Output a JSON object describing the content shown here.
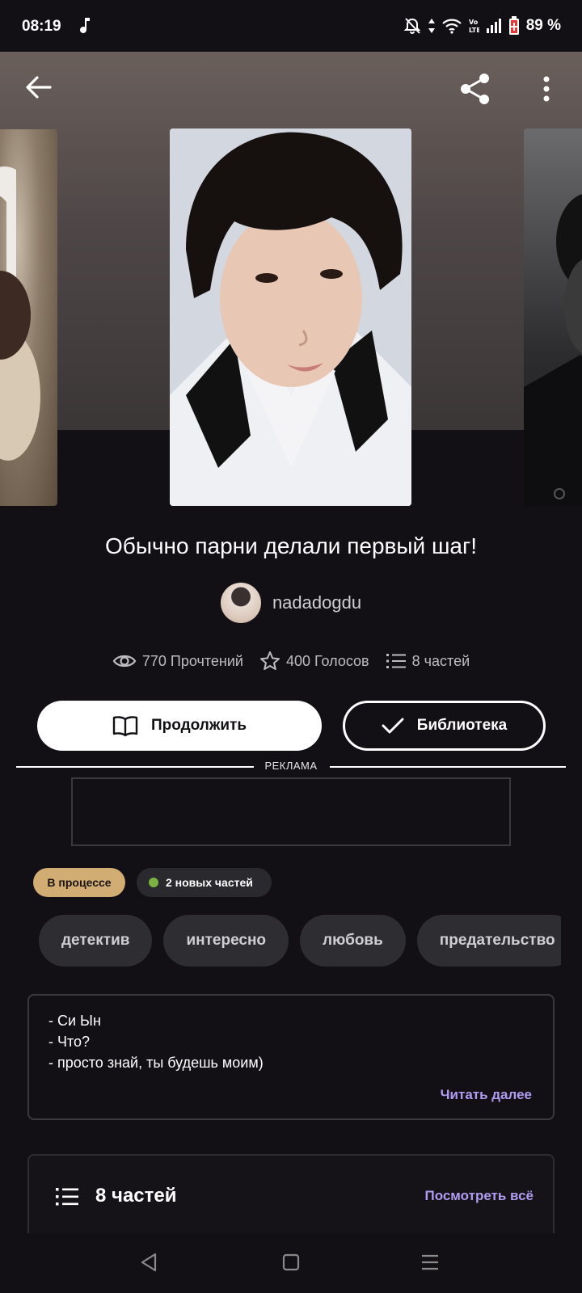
{
  "status_bar": {
    "time": "08:19",
    "battery": "89 %",
    "icons": [
      "music-note-icon",
      "mute-icon",
      "data-arrows-icon",
      "wifi-icon",
      "volte-icon",
      "signal-icon",
      "battery-icon"
    ]
  },
  "header": {
    "icons": [
      "arrow-left-icon",
      "share-icon",
      "more-vertical-icon"
    ]
  },
  "story": {
    "title": "Обычно парни делали первый шаг!",
    "author": "nadadogdu",
    "stats": {
      "reads": "770 Прочтений",
      "votes": "400 Голосов",
      "parts": "8 частей"
    }
  },
  "actions": {
    "continue_label": "Продолжить",
    "library_label": "Библиотека"
  },
  "ad": {
    "label": "РЕКЛАМА"
  },
  "badges": {
    "status": "В процессе",
    "new_parts": "2 новых частей"
  },
  "tags": [
    "детектив",
    "интересно",
    "любовь",
    "предательство"
  ],
  "description": {
    "lines": [
      "- Си Ын",
      "- Что?",
      "- просто знай, ты будешь моим)"
    ],
    "read_more": "Читать далее"
  },
  "parts_section": {
    "title": "8 частей",
    "view_all": "Посмотреть всё"
  },
  "colors": {
    "background": "#121014",
    "accent_link": "#b09cf0",
    "status_badge": "#d1ad74",
    "new_dot": "#7ab342"
  }
}
